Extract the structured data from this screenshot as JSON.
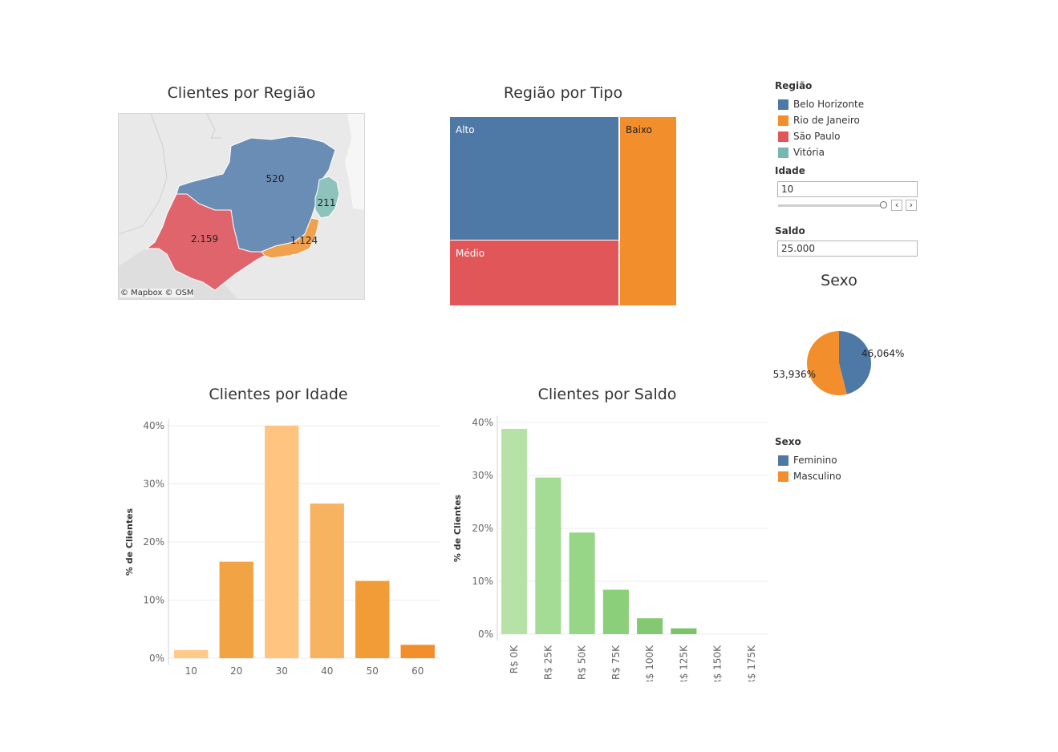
{
  "titles": {
    "map": "Clientes por Região",
    "treemap": "Região por Tipo",
    "age": "Clientes por Idade",
    "balance": "Clientes por Saldo",
    "sex": "Sexo"
  },
  "map": {
    "credit": "© Mapbox © OSM",
    "regions": [
      {
        "name": "Belo Horizonte",
        "value": "520",
        "color": "#6a8db5"
      },
      {
        "name": "Rio de Janeiro",
        "value": "1.124",
        "color": "#f1a04e"
      },
      {
        "name": "São Paulo",
        "value": "2.159",
        "color": "#e0646b"
      },
      {
        "name": "Vitória",
        "value": "211",
        "color": "#8dc3bc"
      }
    ]
  },
  "treemap": {
    "cells": [
      {
        "label": "Alto",
        "color": "#4e79a7"
      },
      {
        "label": "Médio",
        "color": "#e15759"
      },
      {
        "label": "Baixo",
        "color": "#f28e2b"
      }
    ]
  },
  "legend_region": {
    "title": "Região",
    "items": [
      {
        "label": "Belo Horizonte",
        "color": "#4e79a7"
      },
      {
        "label": "Rio de Janeiro",
        "color": "#f28e2b"
      },
      {
        "label": "São Paulo",
        "color": "#e15759"
      },
      {
        "label": "Vitória",
        "color": "#76b7b2"
      }
    ]
  },
  "filters": {
    "idade_label": "Idade",
    "idade_value": "10",
    "saldo_label": "Saldo",
    "saldo_value": "25.000",
    "prev_symbol": "‹",
    "next_symbol": "›"
  },
  "legend_sex": {
    "title": "Sexo",
    "items": [
      {
        "label": "Feminino",
        "color": "#4e79a7"
      },
      {
        "label": "Masculino",
        "color": "#f28e2b"
      }
    ]
  },
  "chart_data": [
    {
      "type": "bar",
      "title": "Clientes por Idade",
      "ylabel": "% de Clientes",
      "xlabel": "",
      "categories": [
        "10",
        "20",
        "30",
        "40",
        "50",
        "60"
      ],
      "values": [
        1.4,
        16.6,
        40.0,
        26.6,
        13.3,
        2.3
      ],
      "colors": [
        "#ffc98a",
        "#f2a444",
        "#ffc580",
        "#f8b360",
        "#f29c38",
        "#f28e2b"
      ],
      "ylim": [
        0,
        40
      ],
      "yticks": [
        "0%",
        "10%",
        "20%",
        "30%",
        "40%"
      ],
      "grid": true
    },
    {
      "type": "bar",
      "title": "Clientes por Saldo",
      "ylabel": "% de Clientes",
      "xlabel": "",
      "categories": [
        "R$ 0K",
        "R$ 25K",
        "R$ 50K",
        "R$ 75K",
        "R$ 100K",
        "R$ 125K",
        "R$ 150K",
        "R$ 175K"
      ],
      "values": [
        38.8,
        29.6,
        19.2,
        8.4,
        3.0,
        1.1,
        0,
        0
      ],
      "colors": [
        "#b6e2a8",
        "#a4db95",
        "#98d687",
        "#8ccf7b",
        "#84c972",
        "#7cc36a",
        "#7cc36a",
        "#7cc36a"
      ],
      "ylim": [
        0,
        40
      ],
      "yticks": [
        "0%",
        "10%",
        "20%",
        "30%",
        "40%"
      ],
      "grid": true
    },
    {
      "type": "pie",
      "title": "Sexo",
      "slices": [
        {
          "name": "Feminino",
          "value": 46.064,
          "label": "46,064%",
          "color": "#4e79a7"
        },
        {
          "name": "Masculino",
          "value": 53.936,
          "label": "53,936%",
          "color": "#f28e2b"
        }
      ]
    }
  ]
}
